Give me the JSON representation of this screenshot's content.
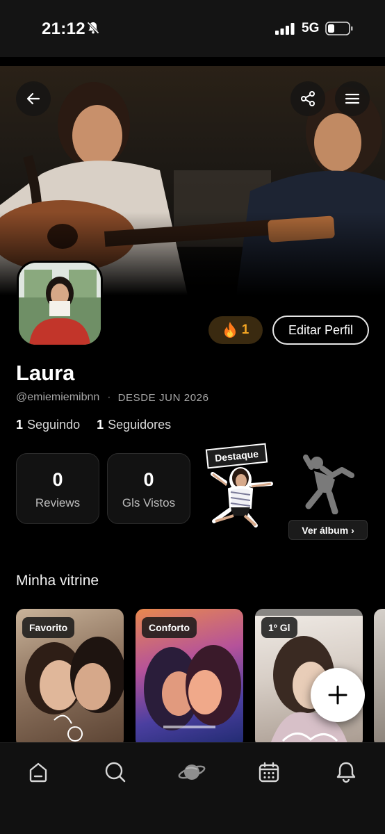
{
  "status_bar": {
    "time": "21:12",
    "network": "5G",
    "icons": [
      "bell-slash-icon",
      "signal-icon",
      "battery-icon"
    ]
  },
  "header": {
    "back_icon": "arrow-left-icon",
    "share_icon": "share-icon",
    "menu_icon": "hamburger-menu-icon"
  },
  "profile": {
    "name": "Laura",
    "handle": "@emiemiemibnn",
    "since": "DESDE JUN 2026",
    "streak": "1",
    "streak_icon": "fire-icon",
    "edit_label": "Editar Perfil",
    "following_count": "1",
    "following_label": "Seguindo",
    "followers_count": "1",
    "followers_label": "Seguidores"
  },
  "stats": [
    {
      "value": "0",
      "label": "Reviews"
    },
    {
      "value": "0",
      "label": "Gls Vistos"
    }
  ],
  "album": {
    "highlight_label": "Destaque",
    "view_label": "Ver álbum ›"
  },
  "vitrine": {
    "title": "Minha vitrine",
    "posters": [
      {
        "badge": "Favorito"
      },
      {
        "badge": "Conforto"
      },
      {
        "badge": "1º Gl"
      }
    ]
  },
  "fab_icon": "plus-icon",
  "bottom_nav": [
    "home-icon",
    "search-icon",
    "planet-icon",
    "calendar-icon",
    "bell-icon"
  ],
  "colors": {
    "background": "#000000",
    "streak_accent": "#f5a623",
    "card": "#121212"
  }
}
